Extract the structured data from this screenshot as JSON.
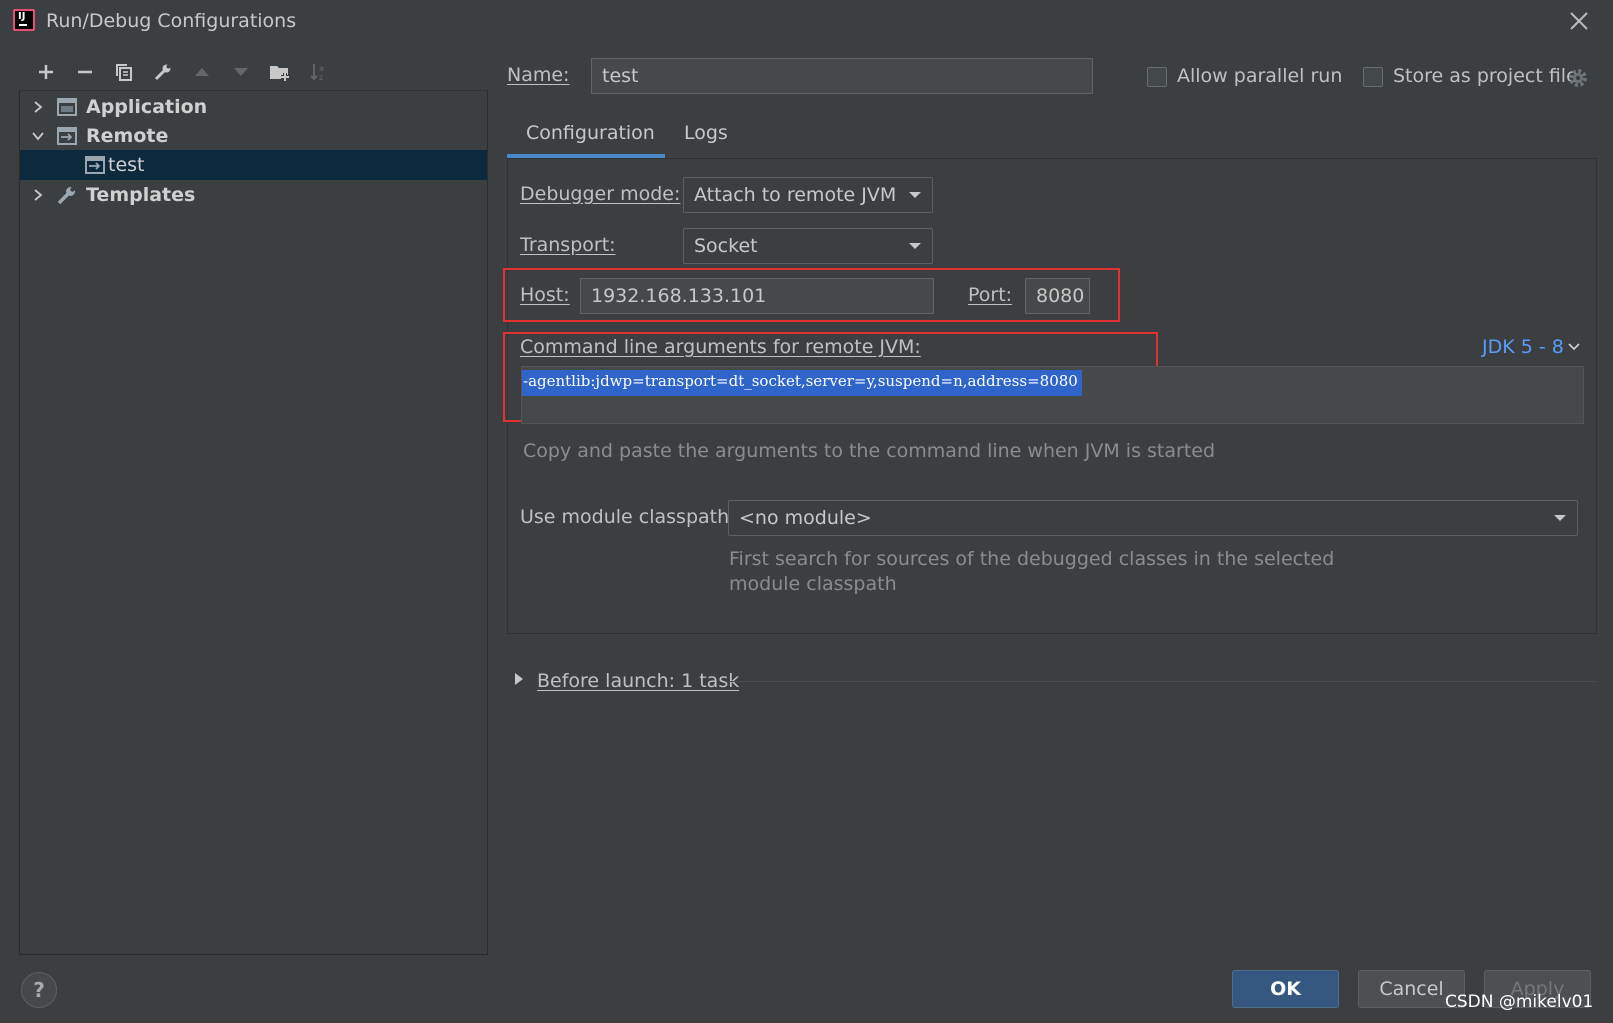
{
  "window": {
    "title": "Run/Debug Configurations",
    "logo_text": "IJ"
  },
  "tree": {
    "items": [
      {
        "label": "Application",
        "expanded": false
      },
      {
        "label": "Remote",
        "expanded": true
      },
      {
        "label": "test",
        "selected": true
      },
      {
        "label": "Templates",
        "expanded": false
      }
    ]
  },
  "header": {
    "name_label": "Name:",
    "name_value": "test",
    "allow_parallel_label": "Allow parallel run",
    "store_project_label": "Store as project file"
  },
  "tabs": [
    {
      "label": "Configuration",
      "active": true
    },
    {
      "label": "Logs",
      "active": false
    }
  ],
  "config": {
    "debugger_mode_label": "Debugger mode:",
    "debugger_mode_value": "Attach to remote JVM",
    "transport_label": "Transport:",
    "transport_value": "Socket",
    "host_label": "Host:",
    "host_value": "1932.168.133.101",
    "port_label": "Port:",
    "port_value": "8080",
    "cmd_label": "Command line arguments for remote JVM:",
    "jdk_link": "JDK 5 - 8",
    "cmd_value": "-agentlib:jdwp=transport=dt_socket,server=y,suspend=n,address=8080",
    "cmd_hint": "Copy and paste the arguments to the command line when JVM is started",
    "module_label": "Use module classpath:",
    "module_value": "<no module>",
    "module_hint_line1": "First search for sources of the debugged classes in the selected",
    "module_hint_line2": "module classpath"
  },
  "before_launch": {
    "label": "Before launch: 1 task"
  },
  "buttons": {
    "ok": "OK",
    "cancel": "Cancel",
    "apply": "Apply",
    "help": "?"
  },
  "watermark": "CSDN @mikelv01",
  "colors": {
    "background": "#3c3f41",
    "selection": "#0d293e",
    "accent": "#4a88c7",
    "highlight_box": "#e03232",
    "link": "#589df6",
    "text_selection": "#2f65ca"
  }
}
